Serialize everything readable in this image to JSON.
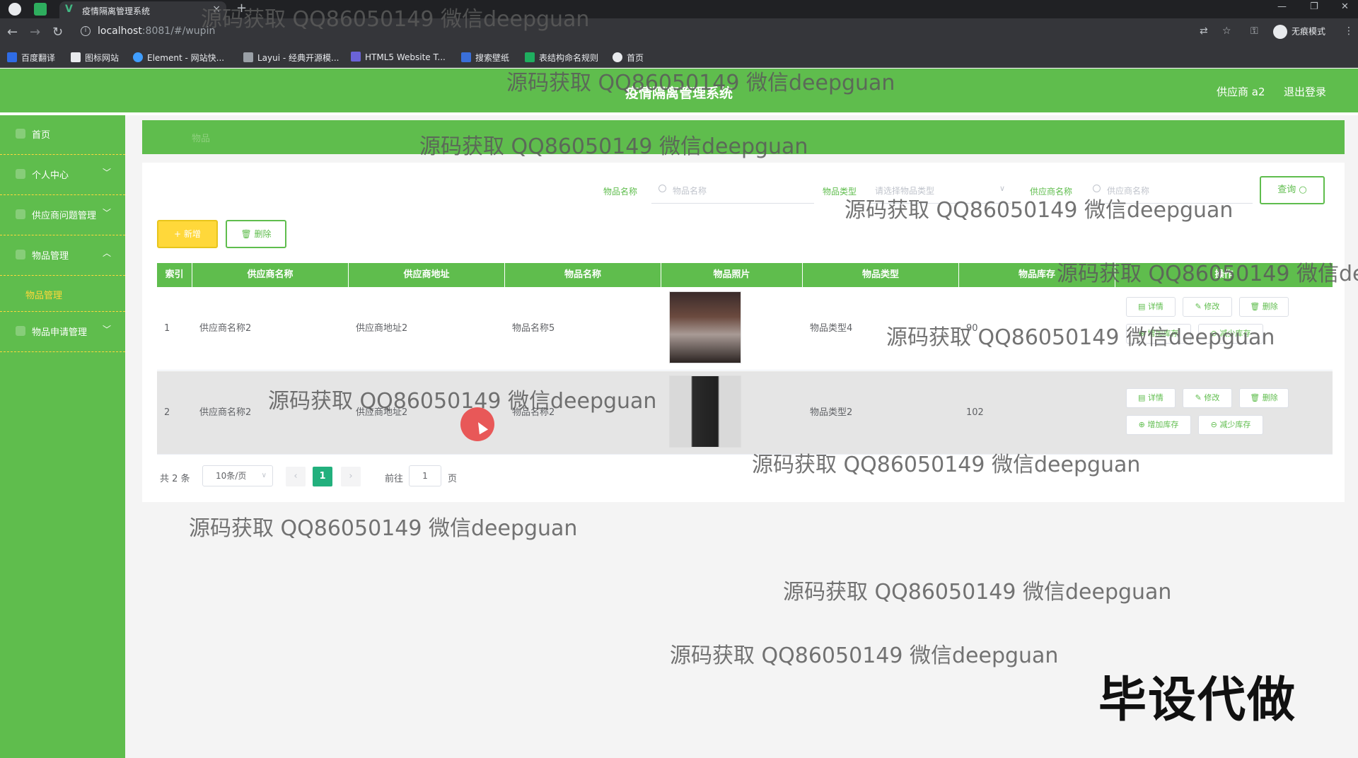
{
  "browser": {
    "tab_title": "疫情隔离管理系统",
    "url_host": "localhost",
    "url_path": ":8081/#/wupin",
    "incognito_label": "无痕模式",
    "bookmarks": [
      "百度翻译",
      "图标网站",
      "Element - 网站快...",
      "Layui - 经典开源模...",
      "HTML5 Website T...",
      "搜索壁纸",
      "表结构命名规则",
      "首页"
    ]
  },
  "header": {
    "title": "疫情隔离管理系统",
    "user": "供应商 a2",
    "logout": "退出登录"
  },
  "sidebar": {
    "items": [
      {
        "label": "首页"
      },
      {
        "label": "个人中心"
      },
      {
        "label": "供应商问题管理"
      },
      {
        "label": "物品管理"
      },
      {
        "label": "物品管理"
      },
      {
        "label": "物品申请管理"
      }
    ]
  },
  "breadcrumb": "物品",
  "search": {
    "name_label": "物品名称",
    "name_placeholder": "物品名称",
    "type_label": "物品类型",
    "type_placeholder": "请选择物品类型",
    "supplier_label": "供应商名称",
    "supplier_placeholder": "供应商名称",
    "query_button": "查询"
  },
  "toolbar": {
    "add": "新增",
    "delete": "删除"
  },
  "table": {
    "columns": [
      "索引",
      "供应商名称",
      "供应商地址",
      "物品名称",
      "物品照片",
      "物品类型",
      "物品库存",
      "操作"
    ],
    "rows": [
      {
        "index": "1",
        "supplier": "供应商名称2",
        "address": "供应商地址2",
        "name": "物品名称5",
        "type": "物品类型4",
        "stock": "90"
      },
      {
        "index": "2",
        "supplier": "供应商名称2",
        "address": "供应商地址2",
        "name": "物品名称2",
        "type": "物品类型2",
        "stock": "102"
      }
    ],
    "actions": {
      "detail": "详情",
      "edit": "修改",
      "remove": "删除",
      "add_stock": "增加库存",
      "reduce_stock": "减少库存"
    }
  },
  "pagination": {
    "total": "共 2 条",
    "page_size": "10条/页",
    "current": "1",
    "goto": "前往",
    "goto_value": "1",
    "page_suffix": "页"
  },
  "overlay": {
    "watermark": "源码获取 QQ86050149 微信deepguan",
    "stamp": "毕设代做"
  },
  "colors": {
    "brand_green": "#5fbd4d",
    "accent_yellow": "#ffd83a",
    "page_active": "#22b07d"
  }
}
